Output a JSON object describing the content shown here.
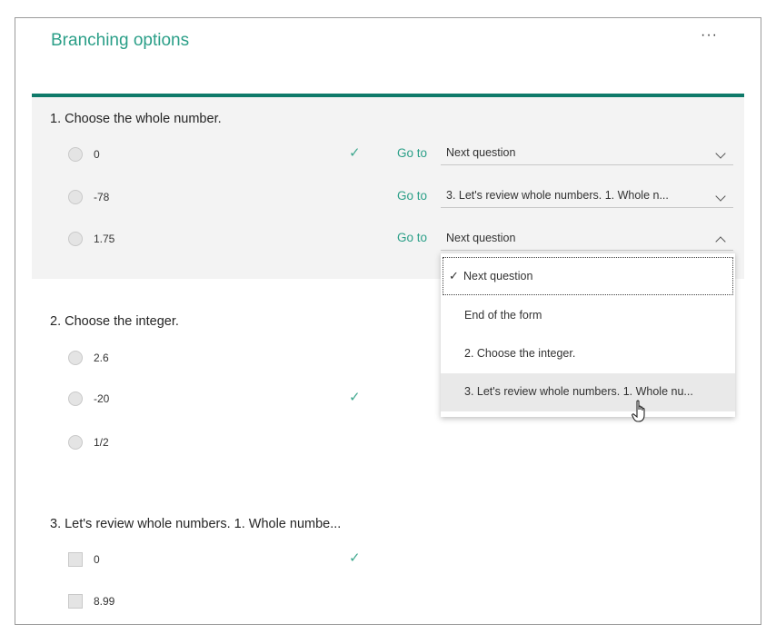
{
  "header": {
    "title": "Branching options",
    "more_label": "···"
  },
  "goto_label": "Go to",
  "questions": [
    {
      "title": "1. Choose the whole number.",
      "options": [
        {
          "label": "0",
          "correct": true,
          "goto": "Next question"
        },
        {
          "label": "-78",
          "correct": false,
          "goto": "3. Let's review whole numbers. 1. Whole n..."
        },
        {
          "label": "1.75",
          "correct": false,
          "goto": "Next question"
        }
      ]
    },
    {
      "title": "2. Choose the integer.",
      "options": [
        {
          "label": "2.6",
          "correct": false
        },
        {
          "label": "-20",
          "correct": true
        },
        {
          "label": "1/2",
          "correct": false
        }
      ]
    },
    {
      "title": "3. Let's review whole numbers. 1. Whole numbe...",
      "options": [
        {
          "label": "0",
          "correct": true
        },
        {
          "label": "8.99",
          "correct": false
        }
      ]
    }
  ],
  "check_glyph": "✓",
  "dropdown": {
    "items": [
      "Next question",
      "End of the form",
      "2. Choose the integer.",
      "3. Let's review whole numbers. 1. Whole nu..."
    ],
    "selected_index": 0,
    "hover_index": 3
  },
  "colors": {
    "accent": "#2b9f88",
    "bar": "#0f7a6a",
    "panel": "#f3f3f3"
  },
  "icons": {
    "more": "more-options-icon",
    "chevron": "chevron-icon",
    "check": "checkmark-icon",
    "cursor": "hand-pointer-icon"
  }
}
